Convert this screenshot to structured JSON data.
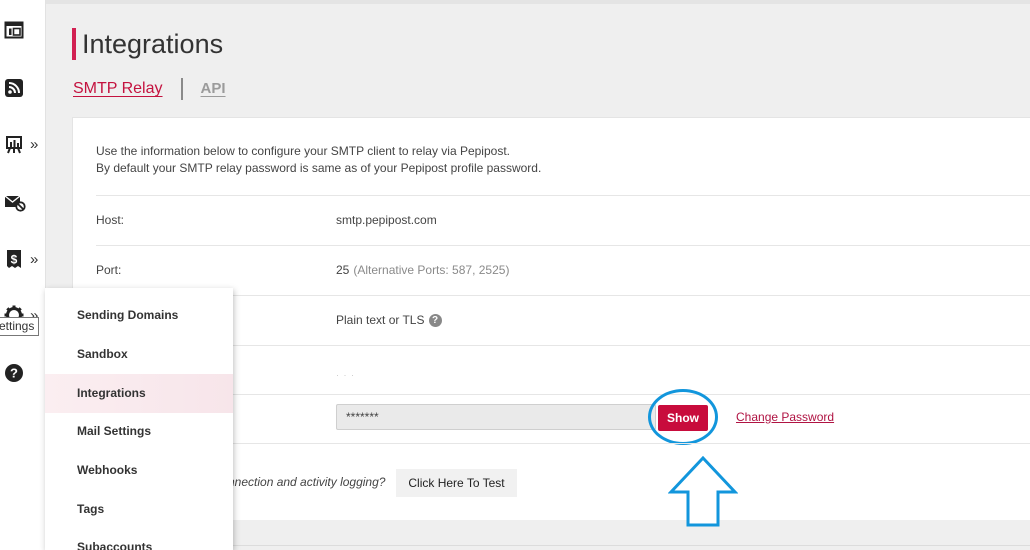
{
  "sidebar": {
    "items": [
      {
        "icon": "layout-icon",
        "has_submenu": false
      },
      {
        "icon": "rss-icon",
        "has_submenu": false
      },
      {
        "icon": "reports-icon",
        "has_submenu": true
      },
      {
        "icon": "mail-block-icon",
        "has_submenu": false
      },
      {
        "icon": "billing-icon",
        "has_submenu": true
      },
      {
        "icon": "gear-icon",
        "has_submenu": true
      },
      {
        "icon": "help-icon",
        "has_submenu": false
      }
    ],
    "chevron": "»",
    "tooltip": "ettings"
  },
  "page": {
    "title": "Integrations",
    "tabs": [
      {
        "label": "SMTP Relay",
        "active": true
      },
      {
        "label": "API",
        "active": false
      }
    ]
  },
  "smtp": {
    "intro_line1": "Use the information below to configure your SMTP client to relay via Pepipost.",
    "intro_line2": "By default your SMTP relay password is same as of your Pepipost profile password.",
    "host_label": "Host:",
    "host_value": "smtp.pepipost.com",
    "port_label": "Port:",
    "port_value": "25",
    "port_alt": "(Alternative Ports: 587, 2525)",
    "encryption_value": "Plain text or TLS",
    "username_value": "· · ·",
    "password_value": "*******",
    "show_label": "Show",
    "change_password_label": "Change Password",
    "test_question": "nnection and activity logging?",
    "test_button_label": "Click Here To Test"
  },
  "settings_menu": {
    "items": [
      {
        "label": "Sending Domains",
        "active": false
      },
      {
        "label": "Sandbox",
        "active": false
      },
      {
        "label": "Integrations",
        "active": true
      },
      {
        "label": "Mail Settings",
        "active": false
      },
      {
        "label": "Webhooks",
        "active": false
      },
      {
        "label": "Tags",
        "active": false
      },
      {
        "label": "Subaccounts",
        "active": false
      }
    ]
  },
  "colors": {
    "accent": "#c80c3c",
    "highlight_circle": "#1296dc",
    "link": "#b01343"
  }
}
